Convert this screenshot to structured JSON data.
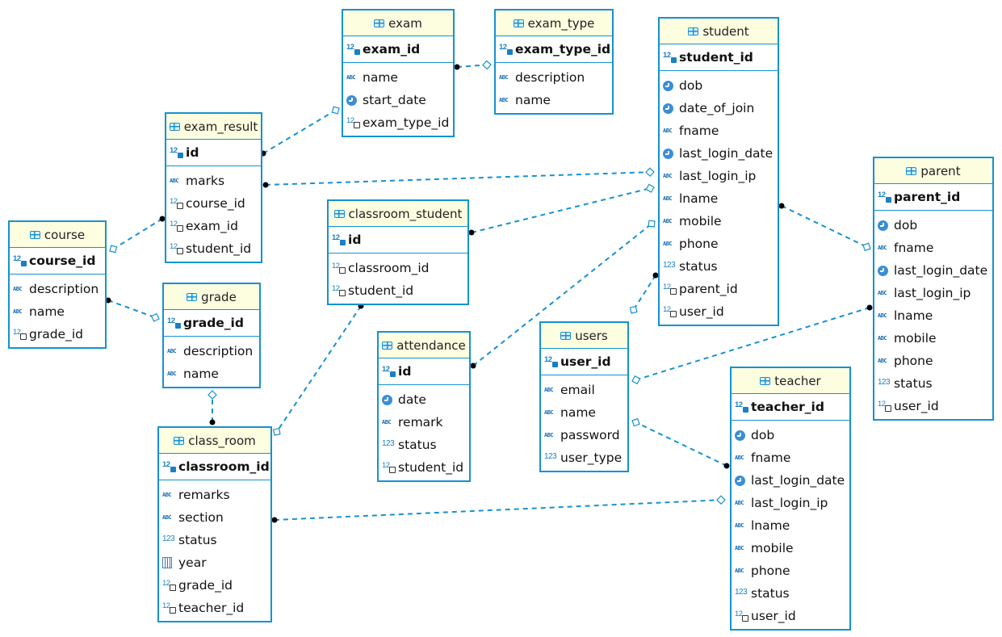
{
  "diagram": {
    "type": "ER diagram",
    "colors": {
      "border": "#1592d0",
      "header_bg": "#fdfde0",
      "link": "#1592d0"
    },
    "entities": [
      {
        "id": "exam",
        "title": "exam",
        "pk": {
          "name": "exam_id",
          "icon": "pk-number"
        },
        "columns": [
          {
            "name": "name",
            "icon": "text"
          },
          {
            "name": "start_date",
            "icon": "datetime"
          },
          {
            "name": "exam_type_id",
            "icon": "fk-number"
          }
        ]
      },
      {
        "id": "exam_type",
        "title": "exam_type",
        "pk": {
          "name": "exam_type_id",
          "icon": "pk-number"
        },
        "columns": [
          {
            "name": "description",
            "icon": "text"
          },
          {
            "name": "name",
            "icon": "text"
          }
        ]
      },
      {
        "id": "student",
        "title": "student",
        "pk": {
          "name": "student_id",
          "icon": "pk-number"
        },
        "columns": [
          {
            "name": "dob",
            "icon": "datetime"
          },
          {
            "name": "date_of_join",
            "icon": "datetime"
          },
          {
            "name": "fname",
            "icon": "text"
          },
          {
            "name": "last_login_date",
            "icon": "datetime"
          },
          {
            "name": "last_login_ip",
            "icon": "text"
          },
          {
            "name": "lname",
            "icon": "text"
          },
          {
            "name": "mobile",
            "icon": "text"
          },
          {
            "name": "phone",
            "icon": "text"
          },
          {
            "name": "status",
            "icon": "number"
          },
          {
            "name": "parent_id",
            "icon": "fk-number"
          },
          {
            "name": "user_id",
            "icon": "fk-number"
          }
        ]
      },
      {
        "id": "exam_result",
        "title": "exam_result",
        "pk": {
          "name": "id",
          "icon": "pk-number"
        },
        "columns": [
          {
            "name": "marks",
            "icon": "text"
          },
          {
            "name": "course_id",
            "icon": "fk-number"
          },
          {
            "name": "exam_id",
            "icon": "fk-number"
          },
          {
            "name": "student_id",
            "icon": "fk-number"
          }
        ]
      },
      {
        "id": "parent",
        "title": "parent",
        "pk": {
          "name": "parent_id",
          "icon": "pk-number"
        },
        "columns": [
          {
            "name": "dob",
            "icon": "datetime"
          },
          {
            "name": "fname",
            "icon": "text"
          },
          {
            "name": "last_login_date",
            "icon": "datetime"
          },
          {
            "name": "last_login_ip",
            "icon": "text"
          },
          {
            "name": "lname",
            "icon": "text"
          },
          {
            "name": "mobile",
            "icon": "text"
          },
          {
            "name": "phone",
            "icon": "text"
          },
          {
            "name": "status",
            "icon": "number"
          },
          {
            "name": "user_id",
            "icon": "fk-number"
          }
        ]
      },
      {
        "id": "classroom_student",
        "title": "classroom_student",
        "pk": {
          "name": "id",
          "icon": "pk-number"
        },
        "columns": [
          {
            "name": "classroom_id",
            "icon": "fk-number"
          },
          {
            "name": "student_id",
            "icon": "fk-number"
          }
        ]
      },
      {
        "id": "course",
        "title": "course",
        "pk": {
          "name": "course_id",
          "icon": "pk-number"
        },
        "columns": [
          {
            "name": "description",
            "icon": "text"
          },
          {
            "name": "name",
            "icon": "text"
          },
          {
            "name": "grade_id",
            "icon": "fk-number"
          }
        ]
      },
      {
        "id": "grade",
        "title": "grade",
        "pk": {
          "name": "grade_id",
          "icon": "pk-number"
        },
        "columns": [
          {
            "name": "description",
            "icon": "text"
          },
          {
            "name": "name",
            "icon": "text"
          }
        ]
      },
      {
        "id": "attendance",
        "title": "attendance",
        "pk": {
          "name": "id",
          "icon": "pk-number"
        },
        "columns": [
          {
            "name": "date",
            "icon": "datetime"
          },
          {
            "name": "remark",
            "icon": "text"
          },
          {
            "name": "status",
            "icon": "number"
          },
          {
            "name": "student_id",
            "icon": "fk-number"
          }
        ]
      },
      {
        "id": "users",
        "title": "users",
        "pk": {
          "name": "user_id",
          "icon": "pk-number"
        },
        "columns": [
          {
            "name": "email",
            "icon": "text"
          },
          {
            "name": "name",
            "icon": "text"
          },
          {
            "name": "password",
            "icon": "text"
          },
          {
            "name": "user_type",
            "icon": "number"
          }
        ]
      },
      {
        "id": "class_room",
        "title": "class_room",
        "pk": {
          "name": "classroom_id",
          "icon": "pk-number"
        },
        "columns": [
          {
            "name": "remarks",
            "icon": "text"
          },
          {
            "name": "section",
            "icon": "text"
          },
          {
            "name": "status",
            "icon": "number"
          },
          {
            "name": "year",
            "icon": "date"
          },
          {
            "name": "grade_id",
            "icon": "fk-number"
          },
          {
            "name": "teacher_id",
            "icon": "fk-number"
          }
        ]
      },
      {
        "id": "teacher",
        "title": "teacher",
        "pk": {
          "name": "teacher_id",
          "icon": "pk-number"
        },
        "columns": [
          {
            "name": "dob",
            "icon": "datetime"
          },
          {
            "name": "fname",
            "icon": "text"
          },
          {
            "name": "last_login_date",
            "icon": "datetime"
          },
          {
            "name": "last_login_ip",
            "icon": "text"
          },
          {
            "name": "lname",
            "icon": "text"
          },
          {
            "name": "mobile",
            "icon": "text"
          },
          {
            "name": "phone",
            "icon": "text"
          },
          {
            "name": "status",
            "icon": "number"
          },
          {
            "name": "user_id",
            "icon": "fk-number"
          }
        ]
      }
    ],
    "relationships": [
      {
        "from": "exam_result",
        "to": "exam"
      },
      {
        "from": "exam",
        "to": "exam_type"
      },
      {
        "from": "exam_result",
        "to": "student"
      },
      {
        "from": "exam_result",
        "to": "course"
      },
      {
        "from": "course",
        "to": "grade"
      },
      {
        "from": "classroom_student",
        "to": "student"
      },
      {
        "from": "classroom_student",
        "to": "class_room"
      },
      {
        "from": "attendance",
        "to": "student"
      },
      {
        "from": "student",
        "to": "users"
      },
      {
        "from": "student",
        "to": "parent"
      },
      {
        "from": "parent",
        "to": "users"
      },
      {
        "from": "teacher",
        "to": "users"
      },
      {
        "from": "class_room",
        "to": "grade"
      },
      {
        "from": "class_room",
        "to": "teacher"
      }
    ]
  }
}
